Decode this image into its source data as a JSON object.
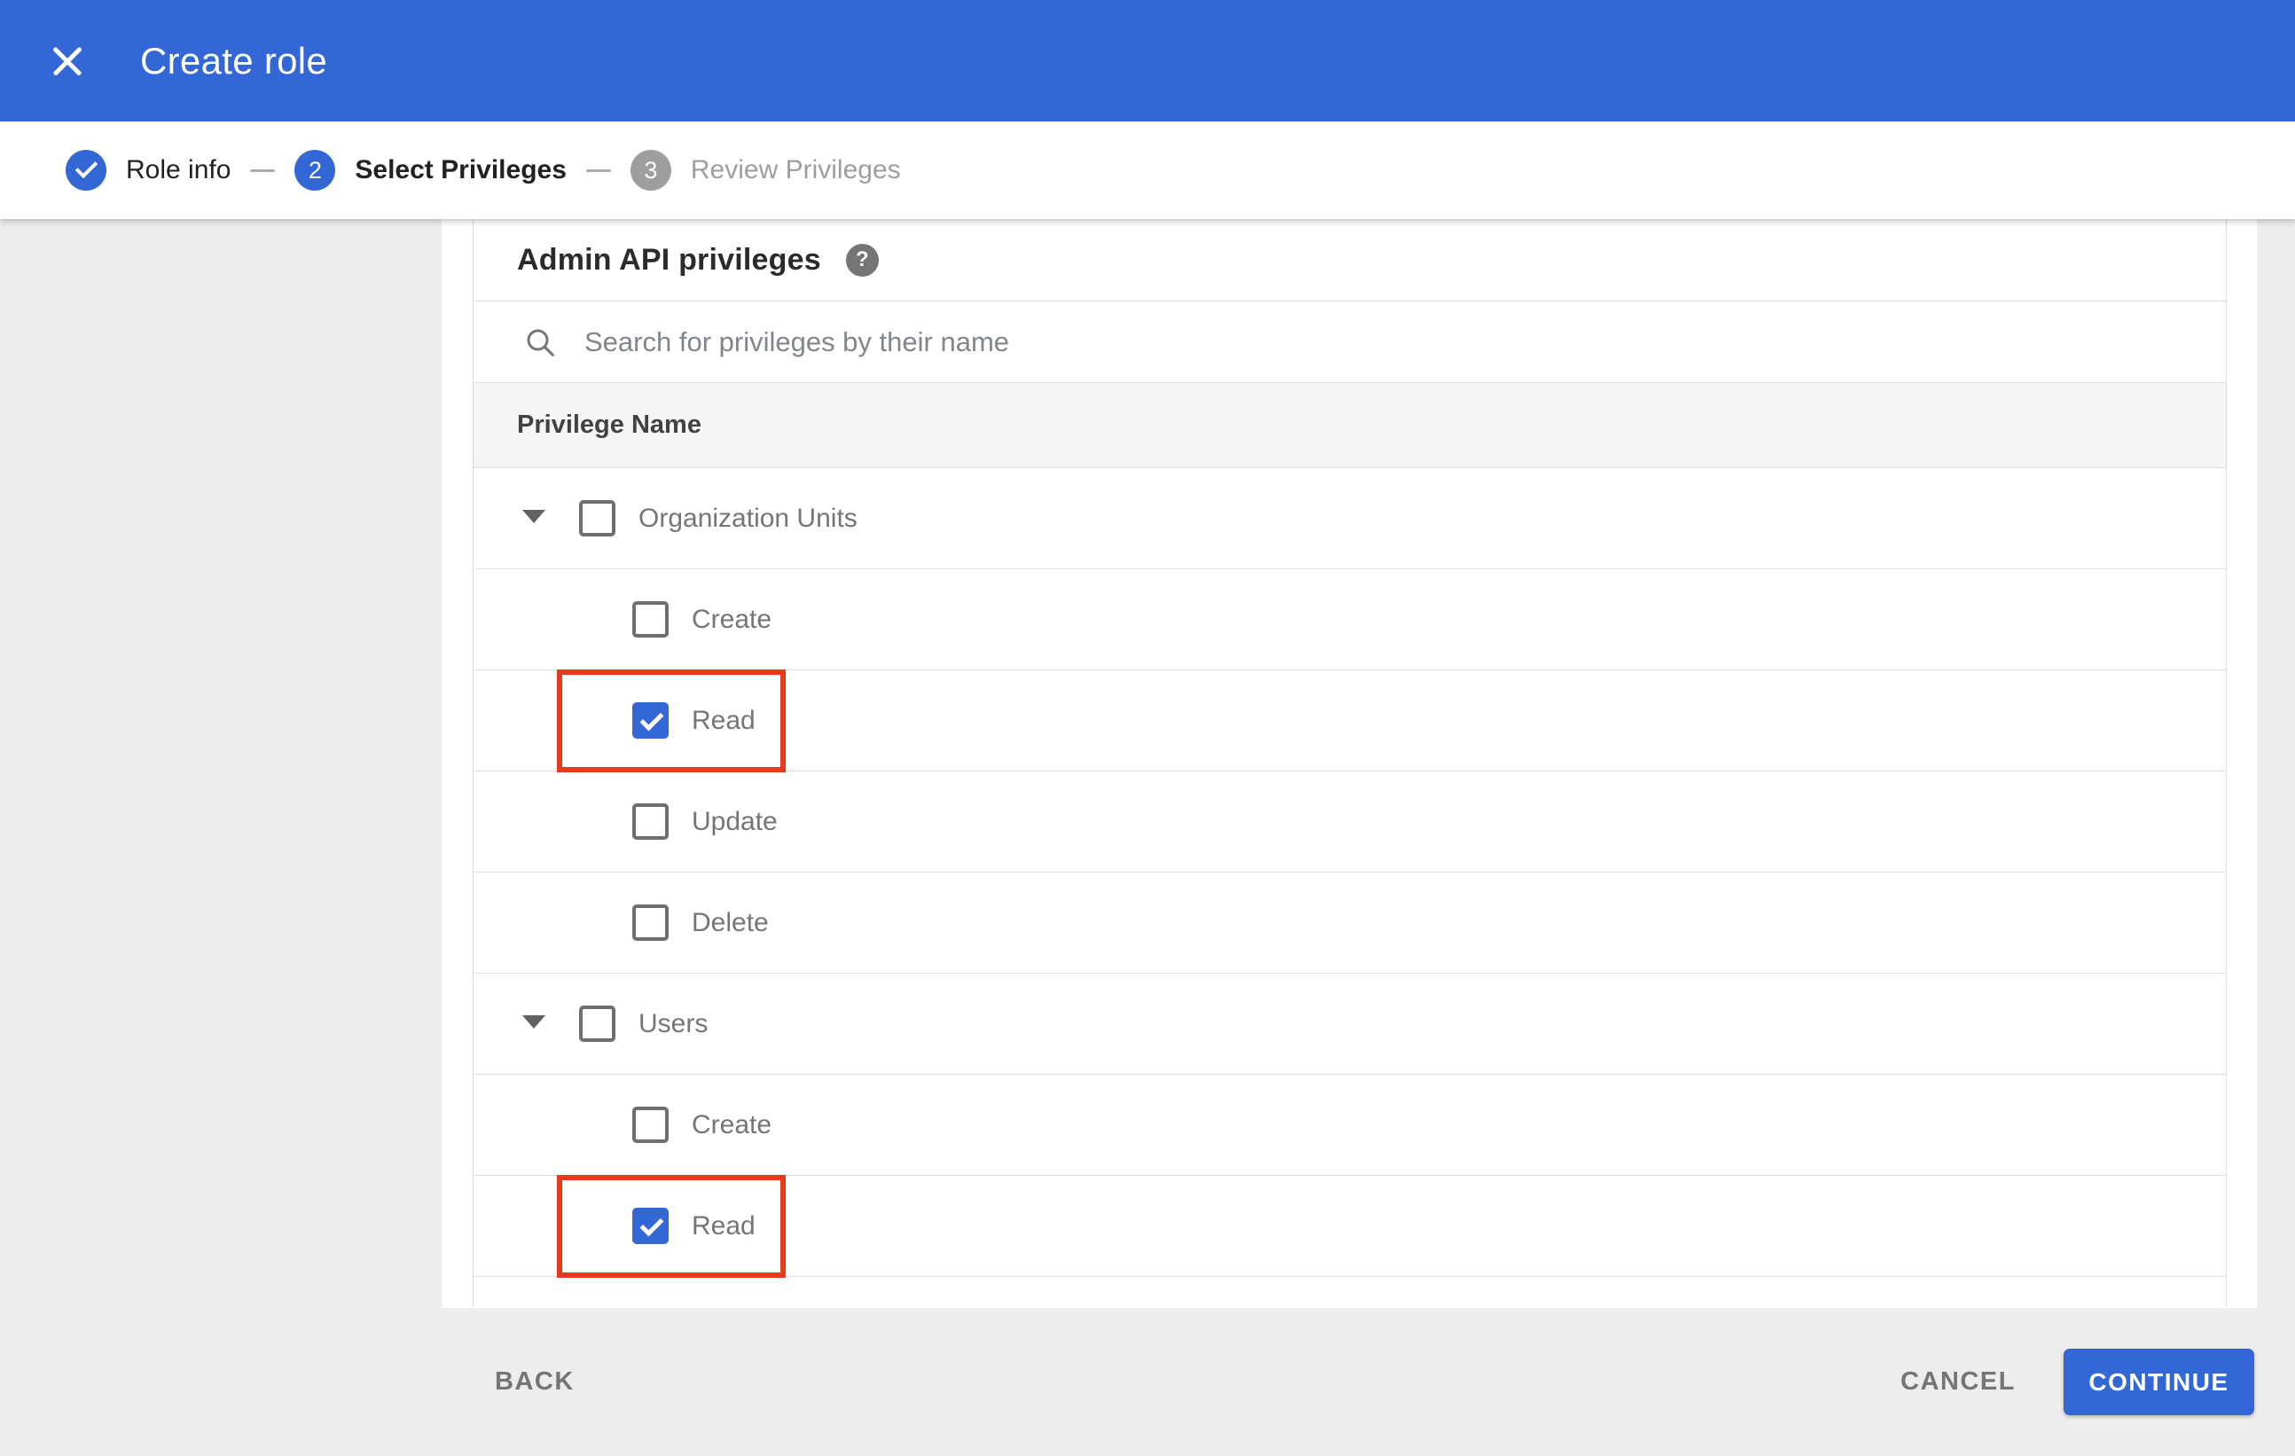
{
  "header": {
    "title": "Create role"
  },
  "stepper": {
    "steps": [
      {
        "label": "Role info",
        "status": "completed"
      },
      {
        "number": "2",
        "label": "Select Privileges",
        "status": "active"
      },
      {
        "number": "3",
        "label": "Review Privileges",
        "status": "upcoming"
      }
    ]
  },
  "panel": {
    "heading": "Admin API privileges",
    "help_glyph": "?",
    "search": {
      "placeholder": "Search for privileges by their name",
      "value": ""
    },
    "table": {
      "header": "Privilege Name",
      "groups": [
        {
          "label": "Organization Units",
          "checked": false,
          "expanded": true,
          "children": [
            {
              "label": "Create",
              "checked": false,
              "highlighted": false
            },
            {
              "label": "Read",
              "checked": true,
              "highlighted": true
            },
            {
              "label": "Update",
              "checked": false,
              "highlighted": false
            },
            {
              "label": "Delete",
              "checked": false,
              "highlighted": false
            }
          ]
        },
        {
          "label": "Users",
          "checked": false,
          "expanded": true,
          "children": [
            {
              "label": "Create",
              "checked": false,
              "highlighted": false
            },
            {
              "label": "Read",
              "checked": true,
              "highlighted": true
            }
          ]
        }
      ]
    }
  },
  "footer": {
    "back_label": "BACK",
    "cancel_label": "CANCEL",
    "continue_label": "CONTINUE"
  },
  "colors": {
    "primary_blue": "#3367d6",
    "annotation_red": "#e8391c",
    "page_gray": "#ededed"
  }
}
